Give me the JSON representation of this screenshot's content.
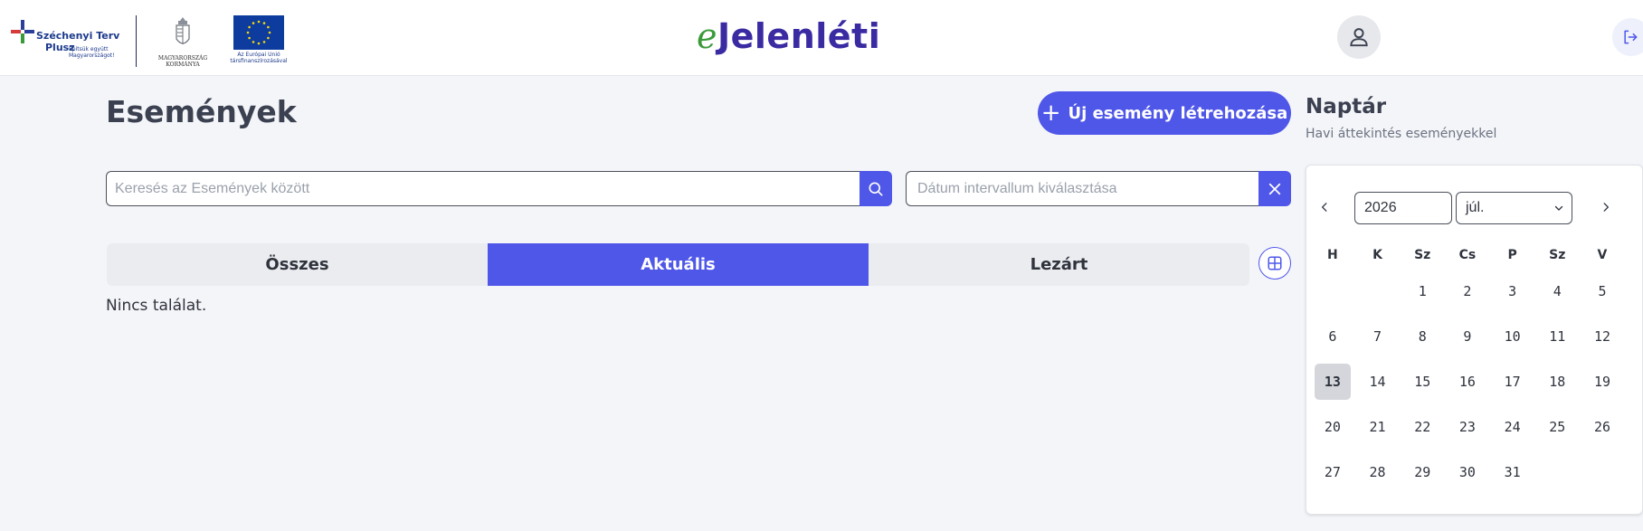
{
  "header": {
    "szechenyi_title_1": "Széchenyi Terv",
    "szechenyi_title_2": "Plusz",
    "szechenyi_sub_1": "Építsük együtt",
    "szechenyi_sub_2": "Magyarországot!",
    "gov_line_1": "MAGYARORSZÁG",
    "gov_line_2": "KORMÁNYA",
    "eu_line_1": "Az Európai Unió",
    "eu_line_2": "társfinanszírozásával",
    "brand_prefix": "e",
    "brand_name": "Jelenléti",
    "avatar_icon": "user-icon",
    "logout_icon": "logout-icon"
  },
  "main": {
    "title": "Események",
    "new_event_label": "Új esemény létrehozása",
    "search_placeholder": "Keresés az Események között",
    "date_placeholder": "Dátum intervallum kiválasztása",
    "tabs": [
      {
        "label": "Összes",
        "active": false
      },
      {
        "label": "Aktuális",
        "active": true
      },
      {
        "label": "Lezárt",
        "active": false
      }
    ],
    "empty_text": "Nincs találat."
  },
  "calendar": {
    "title": "Naptár",
    "subtitle": "Havi áttekintés eseményekkel",
    "year": "2026",
    "month": "júl.",
    "weekdays": [
      "H",
      "K",
      "Sz",
      "Cs",
      "P",
      "Sz",
      "V"
    ],
    "weeks": [
      [
        "",
        "",
        "1",
        "2",
        "3",
        "4",
        "5"
      ],
      [
        "6",
        "7",
        "8",
        "9",
        "10",
        "11",
        "12"
      ],
      [
        "13",
        "14",
        "15",
        "16",
        "17",
        "18",
        "19"
      ],
      [
        "20",
        "21",
        "22",
        "23",
        "24",
        "25",
        "26"
      ],
      [
        "27",
        "28",
        "29",
        "30",
        "31",
        "",
        ""
      ]
    ],
    "today": "13"
  },
  "colors": {
    "accent": "#4f57e8",
    "brand_purple": "#3a2ba3",
    "brand_green": "#3a9a3a"
  }
}
